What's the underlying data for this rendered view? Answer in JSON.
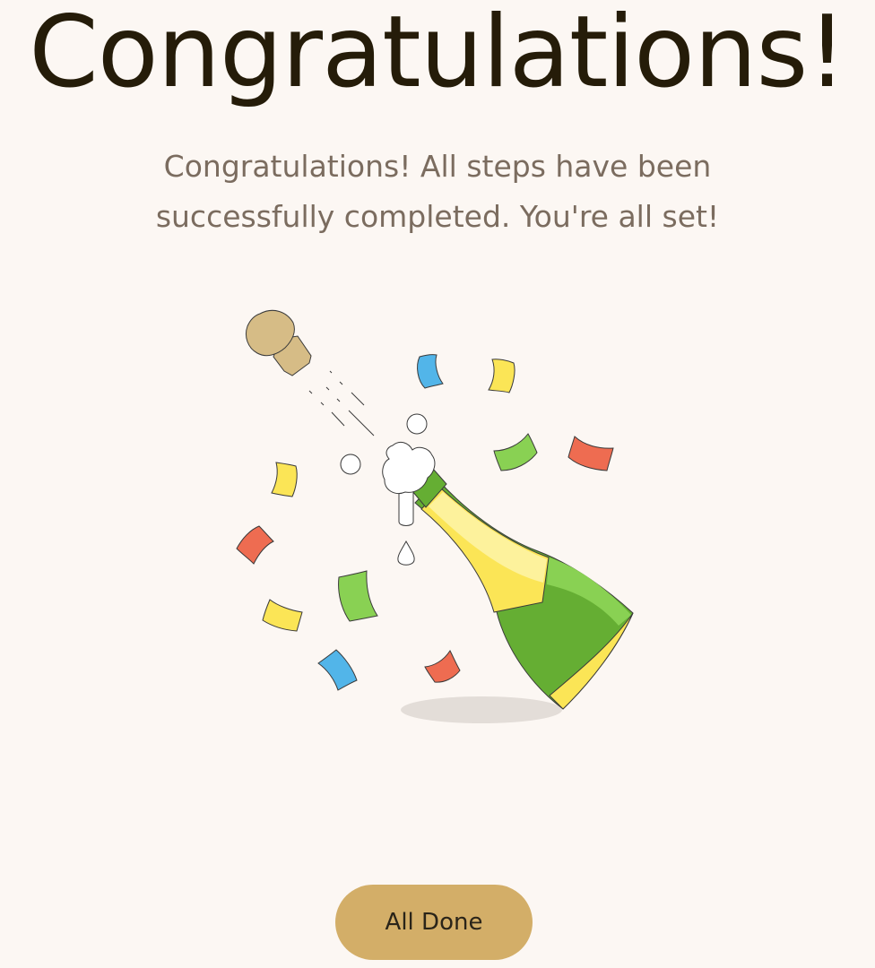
{
  "heading": "Congratulations!",
  "message": "Congratulations! All steps have been successfully completed. You're all set!",
  "illustration": {
    "icon": "champagne-bottle-icon",
    "description_colors": {
      "bottle_green": "#65ae33",
      "label_yellow": "#fbe556",
      "cork_tan": "#d6bc86",
      "confetti_blue": "#52b5e9",
      "confetti_red": "#ee6c51",
      "confetti_green": "#89d153",
      "confetti_yellow": "#fbe556"
    }
  },
  "actions": {
    "done_label": "All Done"
  },
  "colors": {
    "background": "#fcf7f3",
    "heading": "#251c09",
    "message": "#7b6c5f",
    "button_bg": "#d3ae68",
    "button_text": "#2a2419"
  }
}
